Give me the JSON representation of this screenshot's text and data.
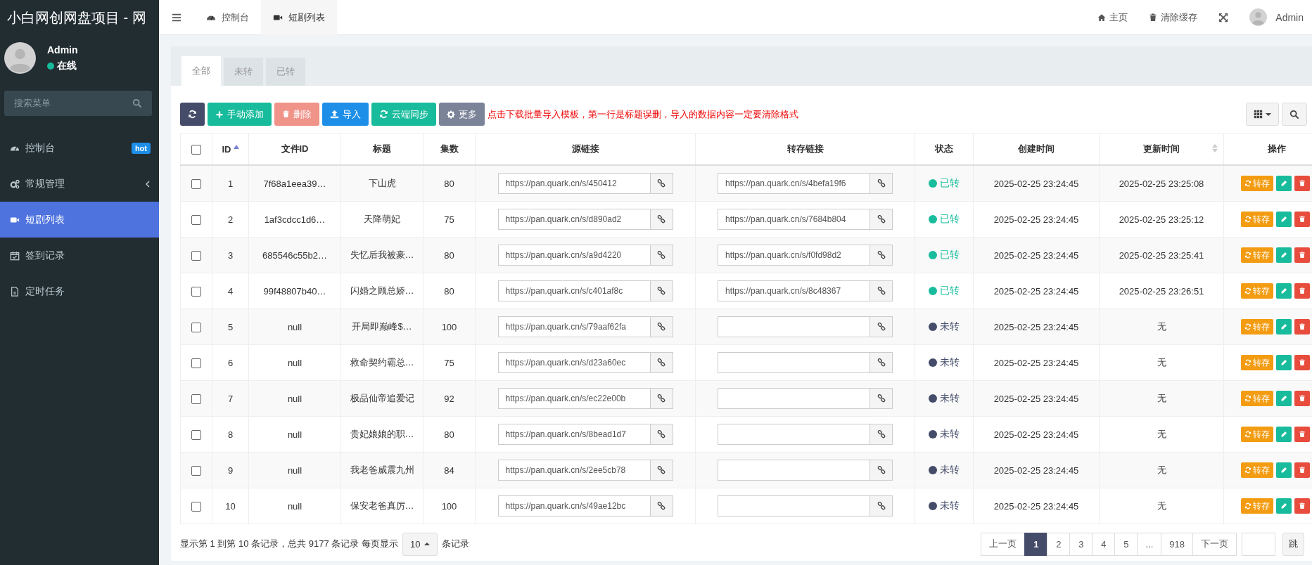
{
  "sidebar": {
    "title": "小白网创网盘项目 - 网",
    "user": {
      "name": "Admin",
      "status": "在线",
      "online": true
    },
    "search": {
      "placeholder": "搜索菜单"
    },
    "items": [
      {
        "label": "控制台",
        "kind": "link",
        "selected": false,
        "badge": "hot"
      },
      {
        "label": "常规管理",
        "kind": "group",
        "selected": false,
        "expanded": false
      },
      {
        "label": "短剧列表",
        "kind": "link",
        "selected": true
      },
      {
        "label": "签到记录",
        "kind": "link",
        "selected": false
      },
      {
        "label": "定时任务",
        "kind": "link",
        "selected": false
      }
    ]
  },
  "header": {
    "tabs": [
      {
        "label": "控制台",
        "selected": false
      },
      {
        "label": "短剧列表",
        "selected": true
      }
    ],
    "links": [
      {
        "label": "主页"
      },
      {
        "label": "清除缓存"
      }
    ],
    "user": "Admin"
  },
  "status_tabs": [
    {
      "label": "全部",
      "selected": true
    },
    {
      "label": "未转",
      "selected": false
    },
    {
      "label": "已转",
      "selected": false
    }
  ],
  "toolbar": {
    "buttons": [
      {
        "kind": "refresh",
        "disabled": false
      },
      {
        "kind": "add",
        "label": "手动添加",
        "disabled": false
      },
      {
        "kind": "delete",
        "label": "删除",
        "disabled": true
      },
      {
        "kind": "import",
        "label": "导入",
        "disabled": false
      },
      {
        "kind": "sync",
        "label": "云端同步",
        "disabled": false
      },
      {
        "kind": "more",
        "label": "更多",
        "disabled": false
      }
    ],
    "notice": "点击下载批量导入模板，第一行是标题误删，导入的数据内容一定要清除格式"
  },
  "table": {
    "columns": [
      {
        "label": "ID",
        "sortable": true,
        "sorted": true
      },
      {
        "label": "文件ID",
        "sortable": false,
        "sorted": false
      },
      {
        "label": "标题",
        "sortable": false,
        "sorted": false
      },
      {
        "label": "集数",
        "sortable": false,
        "sorted": false
      },
      {
        "label": "源链接",
        "sortable": false,
        "sorted": false
      },
      {
        "label": "转存链接",
        "sortable": false,
        "sorted": false
      },
      {
        "label": "状态",
        "sortable": false,
        "sorted": false
      },
      {
        "label": "创建时间",
        "sortable": false,
        "sorted": false
      },
      {
        "label": "更新时间",
        "sortable": true,
        "sorted": false
      },
      {
        "label": "操作",
        "sortable": false,
        "sorted": false
      }
    ],
    "header_checked": false,
    "rows": [
      {
        "checked": false,
        "id": "1",
        "file_id": "7f68a1eea39…",
        "title": "下山虎",
        "episodes": "80",
        "source_link": "https://pan.quark.cn/s/450412",
        "saved_link": "https://pan.quark.cn/s/4befa19f6",
        "status": "已转",
        "color": "#18bc9c",
        "created": "2025-02-25 23:24:45",
        "updated": "2025-02-25 23:25:08",
        "action": "转存"
      },
      {
        "checked": false,
        "id": "2",
        "file_id": "1af3cdcc1d6…",
        "title": "天降萌妃",
        "episodes": "75",
        "source_link": "https://pan.quark.cn/s/d890ad2",
        "saved_link": "https://pan.quark.cn/s/7684b804",
        "status": "已转",
        "color": "#18bc9c",
        "created": "2025-02-25 23:24:45",
        "updated": "2025-02-25 23:25:12",
        "action": "转存"
      },
      {
        "checked": false,
        "id": "3",
        "file_id": "685546c55b2…",
        "title": "失忆后我被豪…",
        "episodes": "80",
        "source_link": "https://pan.quark.cn/s/a9d4220",
        "saved_link": "https://pan.quark.cn/s/f0fd98d2",
        "status": "已转",
        "color": "#18bc9c",
        "created": "2025-02-25 23:24:45",
        "updated": "2025-02-25 23:25:41",
        "action": "转存"
      },
      {
        "checked": false,
        "id": "4",
        "file_id": "99f48807b40…",
        "title": "闪婚之顾总娇…",
        "episodes": "80",
        "source_link": "https://pan.quark.cn/s/c401af8c",
        "saved_link": "https://pan.quark.cn/s/8c48367",
        "status": "已转",
        "color": "#18bc9c",
        "created": "2025-02-25 23:24:45",
        "updated": "2025-02-25 23:26:51",
        "action": "转存"
      },
      {
        "checked": false,
        "id": "5",
        "file_id": "null",
        "title": "开局即巅峰$…",
        "episodes": "100",
        "source_link": "https://pan.quark.cn/s/79aaf62fa",
        "status": "未转",
        "color": "#444c69",
        "created": "2025-02-25 23:24:45",
        "updated": "无",
        "action": "转存"
      },
      {
        "checked": false,
        "id": "6",
        "file_id": "null",
        "title": "救命契约霸总…",
        "episodes": "75",
        "source_link": "https://pan.quark.cn/s/d23a60ec",
        "status": "未转",
        "color": "#444c69",
        "created": "2025-02-25 23:24:45",
        "updated": "无",
        "action": "转存"
      },
      {
        "checked": false,
        "id": "7",
        "file_id": "null",
        "title": "极品仙帝追爱记",
        "episodes": "92",
        "source_link": "https://pan.quark.cn/s/ec22e00b",
        "status": "未转",
        "color": "#444c69",
        "created": "2025-02-25 23:24:45",
        "updated": "无",
        "action": "转存"
      },
      {
        "checked": false,
        "id": "8",
        "file_id": "null",
        "title": "贵妃娘娘的职…",
        "episodes": "80",
        "source_link": "https://pan.quark.cn/s/8bead1d7",
        "status": "未转",
        "color": "#444c69",
        "created": "2025-02-25 23:24:45",
        "updated": "无",
        "action": "转存"
      },
      {
        "checked": false,
        "id": "9",
        "file_id": "null",
        "title": "我老爸威震九州",
        "episodes": "84",
        "source_link": "https://pan.quark.cn/s/2ee5cb78",
        "status": "未转",
        "color": "#444c69",
        "created": "2025-02-25 23:24:45",
        "updated": "无",
        "action": "转存"
      },
      {
        "checked": false,
        "id": "10",
        "file_id": "null",
        "title": "保安老爸真厉…",
        "episodes": "100",
        "source_link": "https://pan.quark.cn/s/49ae12bc",
        "status": "未转",
        "color": "#444c69",
        "created": "2025-02-25 23:24:45",
        "updated": "无",
        "action": "转存"
      }
    ]
  },
  "footer": {
    "summary": "显示第 1 到第 10 条记录，总共 9177 条记录 每页显示",
    "page_size": "10",
    "summary_after": "条记录",
    "pages": [
      {
        "label": "上一页",
        "selected": false
      },
      {
        "label": "1",
        "selected": true
      },
      {
        "label": "2",
        "selected": false
      },
      {
        "label": "3",
        "selected": false
      },
      {
        "label": "4",
        "selected": false
      },
      {
        "label": "5",
        "selected": false
      },
      {
        "label": "...",
        "selected": false
      },
      {
        "label": "918",
        "selected": false
      },
      {
        "label": "下一页",
        "selected": false
      }
    ],
    "jump_button": "跳"
  }
}
